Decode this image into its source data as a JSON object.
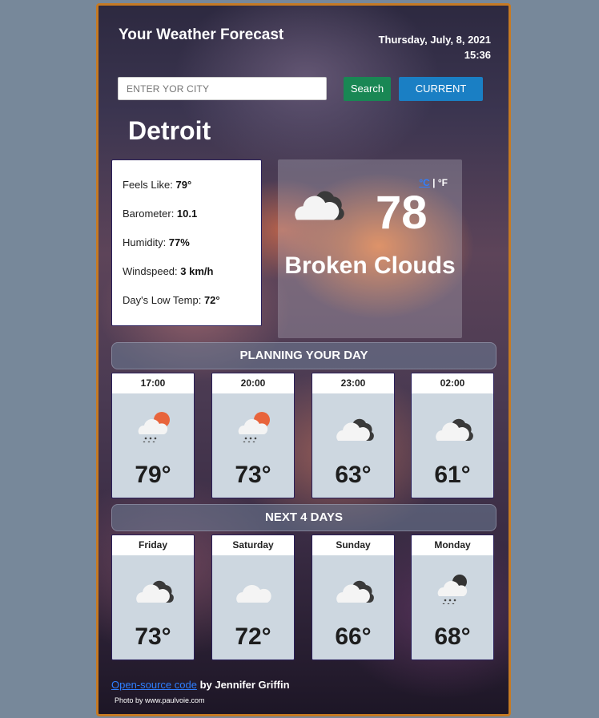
{
  "header": {
    "title": "Your Weather Forecast",
    "date": "Thursday, July, 8, 2021",
    "time": "15:36"
  },
  "search": {
    "placeholder": "ENTER YOR CITY",
    "search_label": "Search",
    "current_label": "CURRENT"
  },
  "city": "Detroit",
  "details": [
    {
      "label": "Feels Like: ",
      "value": "79°"
    },
    {
      "label": "Barometer: ",
      "value": "10.1"
    },
    {
      "label": "Humidity: ",
      "value": "77%"
    },
    {
      "label": "Windspeed: ",
      "value": "3 km/h"
    },
    {
      "label": "Day's Low Temp: ",
      "value": "72°"
    }
  ],
  "current": {
    "temperature": "78",
    "unit_c": "°C",
    "unit_sep": "|",
    "unit_f": "°F",
    "description": "Broken Clouds",
    "icon": "cloudy-icon"
  },
  "planning": {
    "title": "PLANNING YOUR DAY",
    "items": [
      {
        "time": "17:00",
        "temp": "79°",
        "icon": "rain-sun-icon"
      },
      {
        "time": "20:00",
        "temp": "73°",
        "icon": "rain-sun-icon"
      },
      {
        "time": "23:00",
        "temp": "63°",
        "icon": "cloudy-icon"
      },
      {
        "time": "02:00",
        "temp": "61°",
        "icon": "cloudy-icon"
      }
    ]
  },
  "next_days": {
    "title": "NEXT 4 DAYS",
    "items": [
      {
        "day": "Friday",
        "temp": "73°",
        "icon": "cloudy-icon"
      },
      {
        "day": "Saturday",
        "temp": "72°",
        "icon": "cloud-icon"
      },
      {
        "day": "Sunday",
        "temp": "66°",
        "icon": "cloudy-icon"
      },
      {
        "day": "Monday",
        "temp": "68°",
        "icon": "rain-night-icon"
      }
    ]
  },
  "footer": {
    "link_text": "Open-source code",
    "author": " by Jennifer Griffin",
    "credit": "Photo by www.paulvoie.com"
  },
  "colors": {
    "search_button": "#198754",
    "current_button": "#1a7fc4",
    "border": "#c57a24",
    "sun": "#e8643c"
  }
}
